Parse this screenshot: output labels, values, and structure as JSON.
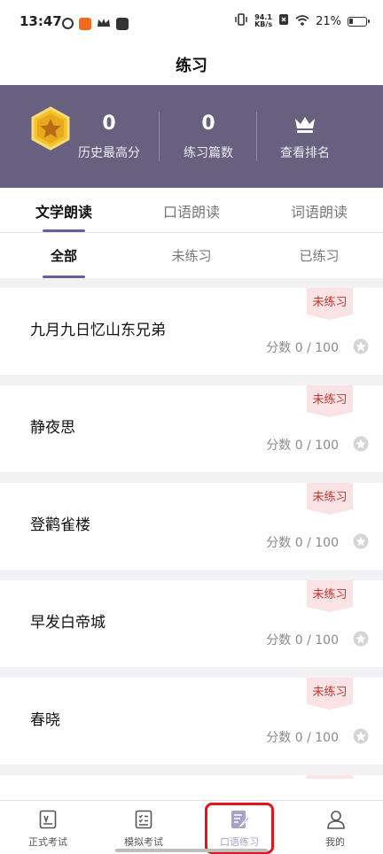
{
  "status_bar": {
    "time": "13:47",
    "net_speed_value": "94.1",
    "net_speed_unit": "KB/s",
    "battery": "21%"
  },
  "header": {
    "title": "练习"
  },
  "stats": {
    "high_score_value": "0",
    "high_score_label": "历史最高分",
    "practice_count_value": "0",
    "practice_count_label": "练习篇数",
    "ranking_label": "查看排名"
  },
  "tabs": [
    {
      "label": "文学朗读",
      "active": true
    },
    {
      "label": "口语朗读",
      "active": false
    },
    {
      "label": "词语朗读",
      "active": false
    }
  ],
  "filters": [
    {
      "label": "全部",
      "active": true
    },
    {
      "label": "未练习",
      "active": false
    },
    {
      "label": "已练习",
      "active": false
    }
  ],
  "items": [
    {
      "title": "九月九日忆山东兄弟",
      "status": "未练习",
      "score": "分数 0 / 100"
    },
    {
      "title": "静夜思",
      "status": "未练习",
      "score": "分数 0 / 100"
    },
    {
      "title": "登鹳雀楼",
      "status": "未练习",
      "score": "分数 0 / 100"
    },
    {
      "title": "早发白帝城",
      "status": "未练习",
      "score": "分数 0 / 100"
    },
    {
      "title": "春晓",
      "status": "未练习",
      "score": "分数 0 / 100"
    }
  ],
  "bottom_nav": [
    {
      "label": "正式考试",
      "icon": "exam-paper-icon",
      "active": false
    },
    {
      "label": "模拟考试",
      "icon": "checklist-icon",
      "active": false
    },
    {
      "label": "口语练习",
      "icon": "edit-doc-icon",
      "active": true
    },
    {
      "label": "我的",
      "icon": "user-icon",
      "active": false
    }
  ],
  "colors": {
    "banner": "#67617f",
    "accent": "#6a5f9a",
    "status_tag_bg": "#fbe3e5",
    "status_tag_text": "#c2362f",
    "highlight": "#e0161c"
  }
}
